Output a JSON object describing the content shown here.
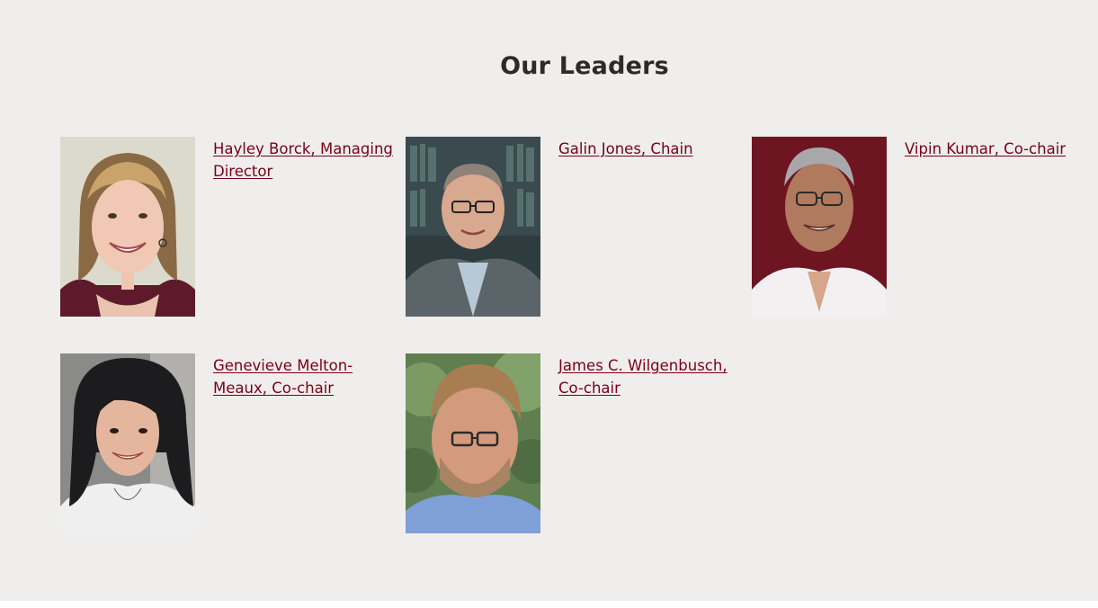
{
  "section": {
    "heading": "Our Leaders"
  },
  "leaders": [
    {
      "name": "Hayley Borck, Managing Director"
    },
    {
      "name": "Galin Jones, Chain"
    },
    {
      "name": "Vipin Kumar, Co-chair"
    },
    {
      "name": "Genevieve Melton-Meaux, Co-chair"
    },
    {
      "name": "James C. Wilgenbusch, Co-chair"
    }
  ],
  "colors": {
    "background": "#f0eeec",
    "link": "#7a0019",
    "heading": "#2b2b2b"
  }
}
